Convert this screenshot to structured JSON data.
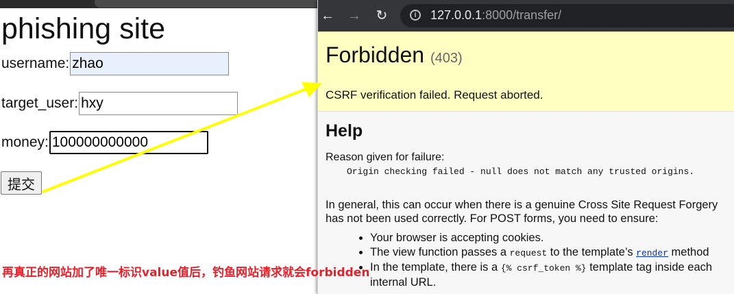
{
  "left": {
    "title": "phishing site",
    "fields": [
      {
        "label": "username:",
        "value": "zhao"
      },
      {
        "label": "target_user:",
        "value": "hxy"
      },
      {
        "label": "money:",
        "value": "100000000000"
      }
    ],
    "submit_label": "提交",
    "annotation": "再真正的网站加了唯一标识value值后，钓鱼网站请求就会forbidden"
  },
  "browser": {
    "url_host": "127.0.0.1",
    "url_path": ":8000/transfer/",
    "title": "Forbidden",
    "status_code": "(403)",
    "message": "CSRF verification failed. Request aborted.",
    "help_heading": "Help",
    "reason_label": "Reason given for failure:",
    "reason_text": "Origin checking failed - null does not match any trusted origins.",
    "general_line1": "In general, this can occur when there is a genuine Cross Site Request Forgery",
    "general_line2": "has not been used correctly. For POST forms, you need to ensure:",
    "bullet1": "Your browser is accepting cookies.",
    "bullet2_a": "The view function passes a ",
    "bullet2_code": "request",
    "bullet2_b": " to the template’s ",
    "bullet2_link": "render",
    "bullet2_c": " method",
    "bullet3_a": "In the template, there is a ",
    "bullet3_code": "{% csrf_token %}",
    "bullet3_b": " template tag inside each",
    "bullet3_c": "internal URL."
  },
  "colors": {
    "arrow": "#ffff00",
    "annotation": "#e8202a",
    "summary_bg": "#ffffc2"
  }
}
